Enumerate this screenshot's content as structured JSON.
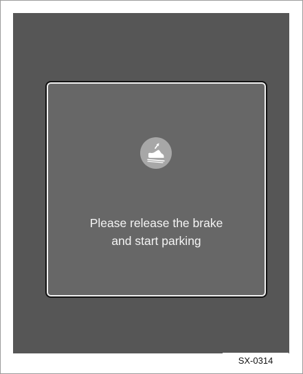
{
  "dialog": {
    "icon": "brake-release-foot-icon",
    "message_line1": "Please release the brake",
    "message_line2": "and start parking"
  },
  "figure_code": "SX-0314",
  "colors": {
    "screen_background": "#565656",
    "dialog_background": "#676767",
    "icon_circle": "#a7a7a7",
    "text": "#f4f4f4"
  }
}
